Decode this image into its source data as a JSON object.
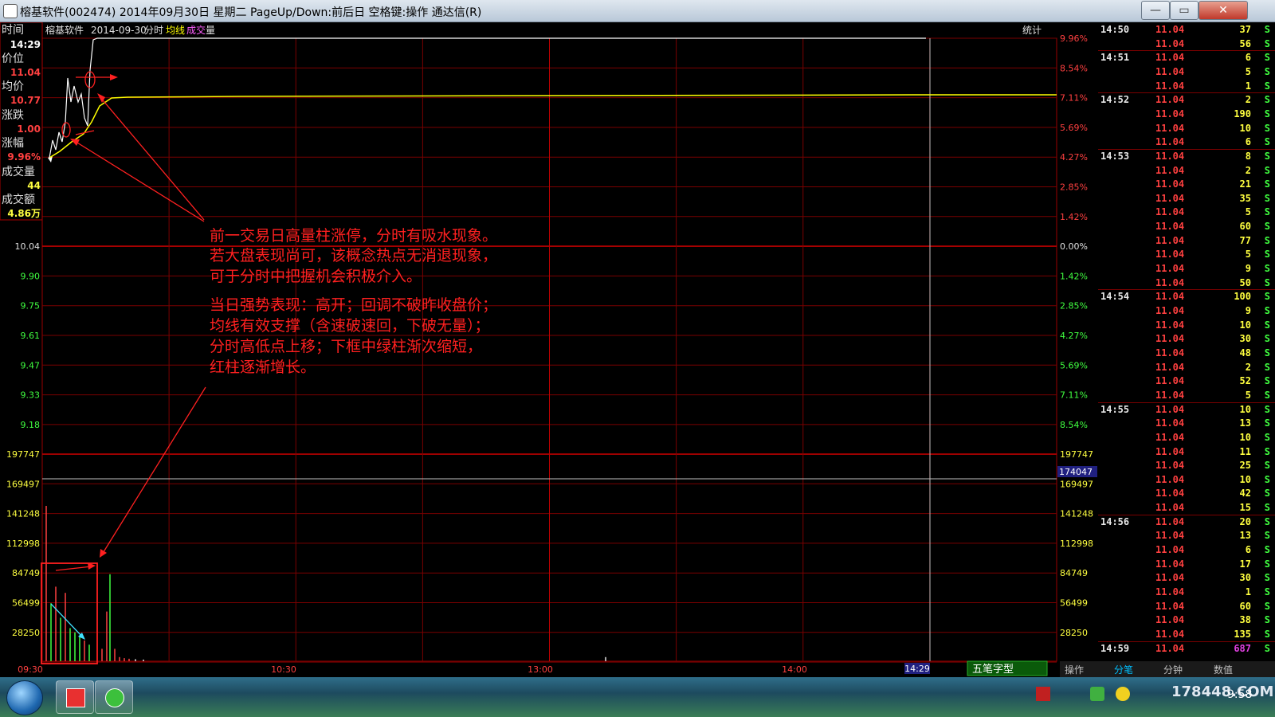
{
  "window": {
    "title": "榕基软件(002474) 2014年09月30日 星期二 PageUp/Down:前后日 空格键:操作 通达信(R)",
    "minimize": "—",
    "maximize": "▭",
    "close": "✕"
  },
  "chart_header": {
    "stock_name": "榕基软件",
    "date": "2014-09-30",
    "mode": "分时",
    "avg_label": "均线",
    "vol_label_1": "成交",
    "vol_label_2": "量",
    "stats_label": "统计"
  },
  "info_panel": {
    "time_label": "时间",
    "time_value": "14:29",
    "price_label": "价位",
    "price_value": "11.04",
    "avg_label": "均价",
    "avg_value": "10.77",
    "change_label": "涨跌",
    "change_value": "1.00",
    "pct_label": "涨幅",
    "pct_value": "9.96%",
    "vol_label": "成交量",
    "vol_value": "44",
    "amount_label": "成交额",
    "amount_value": "4.86万"
  },
  "price_axis_left": [
    "10.04",
    "9.90",
    "9.75",
    "9.61",
    "9.47",
    "9.33",
    "9.18"
  ],
  "pct_axis_right": [
    "9.96%",
    "8.54%",
    "7.11%",
    "5.69%",
    "4.27%",
    "2.85%",
    "1.42%",
    "0.00%",
    "1.42%",
    "2.85%",
    "4.27%",
    "5.69%",
    "7.11%",
    "8.54%"
  ],
  "volume_axis": [
    "197747",
    "169497",
    "141248",
    "112998",
    "84749",
    "56499",
    "28250"
  ],
  "volume_cursor_value": "174047",
  "time_axis": [
    "09:30",
    "10:30",
    "13:00",
    "14:00"
  ],
  "time_cursor_value": "14:29",
  "annotation": {
    "line1": "前一交易日高量柱涨停，分时有吸水现象。",
    "line2": "若大盘表现尚可，该概念热点无消退现象，",
    "line3": "可于分时中把握机会积极介入。",
    "line4": "当日强势表现：高开；回调不破昨收盘价；",
    "line5": "均线有效支撑（含速破速回，下破无量）；",
    "line6": "分时高低点上移；下框中绿柱渐次缩短，",
    "line7": "红柱逐渐增长。"
  },
  "ime": {
    "label": "五笔字型"
  },
  "ticks": [
    {
      "time": "14:50",
      "price": "11.04",
      "vol": "37",
      "side": "S"
    },
    {
      "time": "",
      "price": "11.04",
      "vol": "56",
      "side": "S"
    },
    {
      "time": "14:51",
      "price": "11.04",
      "vol": "6",
      "side": "S"
    },
    {
      "time": "",
      "price": "11.04",
      "vol": "5",
      "side": "S"
    },
    {
      "time": "",
      "price": "11.04",
      "vol": "1",
      "side": "S"
    },
    {
      "time": "14:52",
      "price": "11.04",
      "vol": "2",
      "side": "S"
    },
    {
      "time": "",
      "price": "11.04",
      "vol": "190",
      "side": "S"
    },
    {
      "time": "",
      "price": "11.04",
      "vol": "10",
      "side": "S"
    },
    {
      "time": "",
      "price": "11.04",
      "vol": "6",
      "side": "S"
    },
    {
      "time": "14:53",
      "price": "11.04",
      "vol": "8",
      "side": "S"
    },
    {
      "time": "",
      "price": "11.04",
      "vol": "2",
      "side": "S"
    },
    {
      "time": "",
      "price": "11.04",
      "vol": "21",
      "side": "S"
    },
    {
      "time": "",
      "price": "11.04",
      "vol": "35",
      "side": "S"
    },
    {
      "time": "",
      "price": "11.04",
      "vol": "5",
      "side": "S"
    },
    {
      "time": "",
      "price": "11.04",
      "vol": "60",
      "side": "S"
    },
    {
      "time": "",
      "price": "11.04",
      "vol": "77",
      "side": "S"
    },
    {
      "time": "",
      "price": "11.04",
      "vol": "5",
      "side": "S"
    },
    {
      "time": "",
      "price": "11.04",
      "vol": "9",
      "side": "S"
    },
    {
      "time": "",
      "price": "11.04",
      "vol": "50",
      "side": "S"
    },
    {
      "time": "14:54",
      "price": "11.04",
      "vol": "100",
      "side": "S"
    },
    {
      "time": "",
      "price": "11.04",
      "vol": "9",
      "side": "S"
    },
    {
      "time": "",
      "price": "11.04",
      "vol": "10",
      "side": "S"
    },
    {
      "time": "",
      "price": "11.04",
      "vol": "30",
      "side": "S"
    },
    {
      "time": "",
      "price": "11.04",
      "vol": "48",
      "side": "S"
    },
    {
      "time": "",
      "price": "11.04",
      "vol": "2",
      "side": "S"
    },
    {
      "time": "",
      "price": "11.04",
      "vol": "52",
      "side": "S"
    },
    {
      "time": "",
      "price": "11.04",
      "vol": "5",
      "side": "S"
    },
    {
      "time": "14:55",
      "price": "11.04",
      "vol": "10",
      "side": "S"
    },
    {
      "time": "",
      "price": "11.04",
      "vol": "13",
      "side": "S"
    },
    {
      "time": "",
      "price": "11.04",
      "vol": "10",
      "side": "S"
    },
    {
      "time": "",
      "price": "11.04",
      "vol": "11",
      "side": "S"
    },
    {
      "time": "",
      "price": "11.04",
      "vol": "25",
      "side": "S"
    },
    {
      "time": "",
      "price": "11.04",
      "vol": "10",
      "side": "S"
    },
    {
      "time": "",
      "price": "11.04",
      "vol": "42",
      "side": "S"
    },
    {
      "time": "",
      "price": "11.04",
      "vol": "15",
      "side": "S"
    },
    {
      "time": "14:56",
      "price": "11.04",
      "vol": "20",
      "side": "S"
    },
    {
      "time": "",
      "price": "11.04",
      "vol": "13",
      "side": "S"
    },
    {
      "time": "",
      "price": "11.04",
      "vol": "6",
      "side": "S"
    },
    {
      "time": "",
      "price": "11.04",
      "vol": "17",
      "side": "S"
    },
    {
      "time": "",
      "price": "11.04",
      "vol": "30",
      "side": "S"
    },
    {
      "time": "",
      "price": "11.04",
      "vol": "1",
      "side": "S"
    },
    {
      "time": "",
      "price": "11.04",
      "vol": "60",
      "side": "S"
    },
    {
      "time": "",
      "price": "11.04",
      "vol": "38",
      "side": "S"
    },
    {
      "time": "",
      "price": "11.04",
      "vol": "135",
      "side": "S"
    },
    {
      "time": "14:59",
      "price": "11.04",
      "vol": "687",
      "side": "S"
    }
  ],
  "tabs": [
    "操作",
    "分笔",
    "分钟",
    "数值"
  ],
  "taskbar": {
    "clock": "9:58",
    "watermark": "178448.COM"
  },
  "colors": {
    "grid": "#7a0000",
    "price_up": "#ff4040",
    "price_line": "#ffffff",
    "avg_line": "#ffff00",
    "vol_green": "#40ff40",
    "annotation": "#ff2020"
  }
}
